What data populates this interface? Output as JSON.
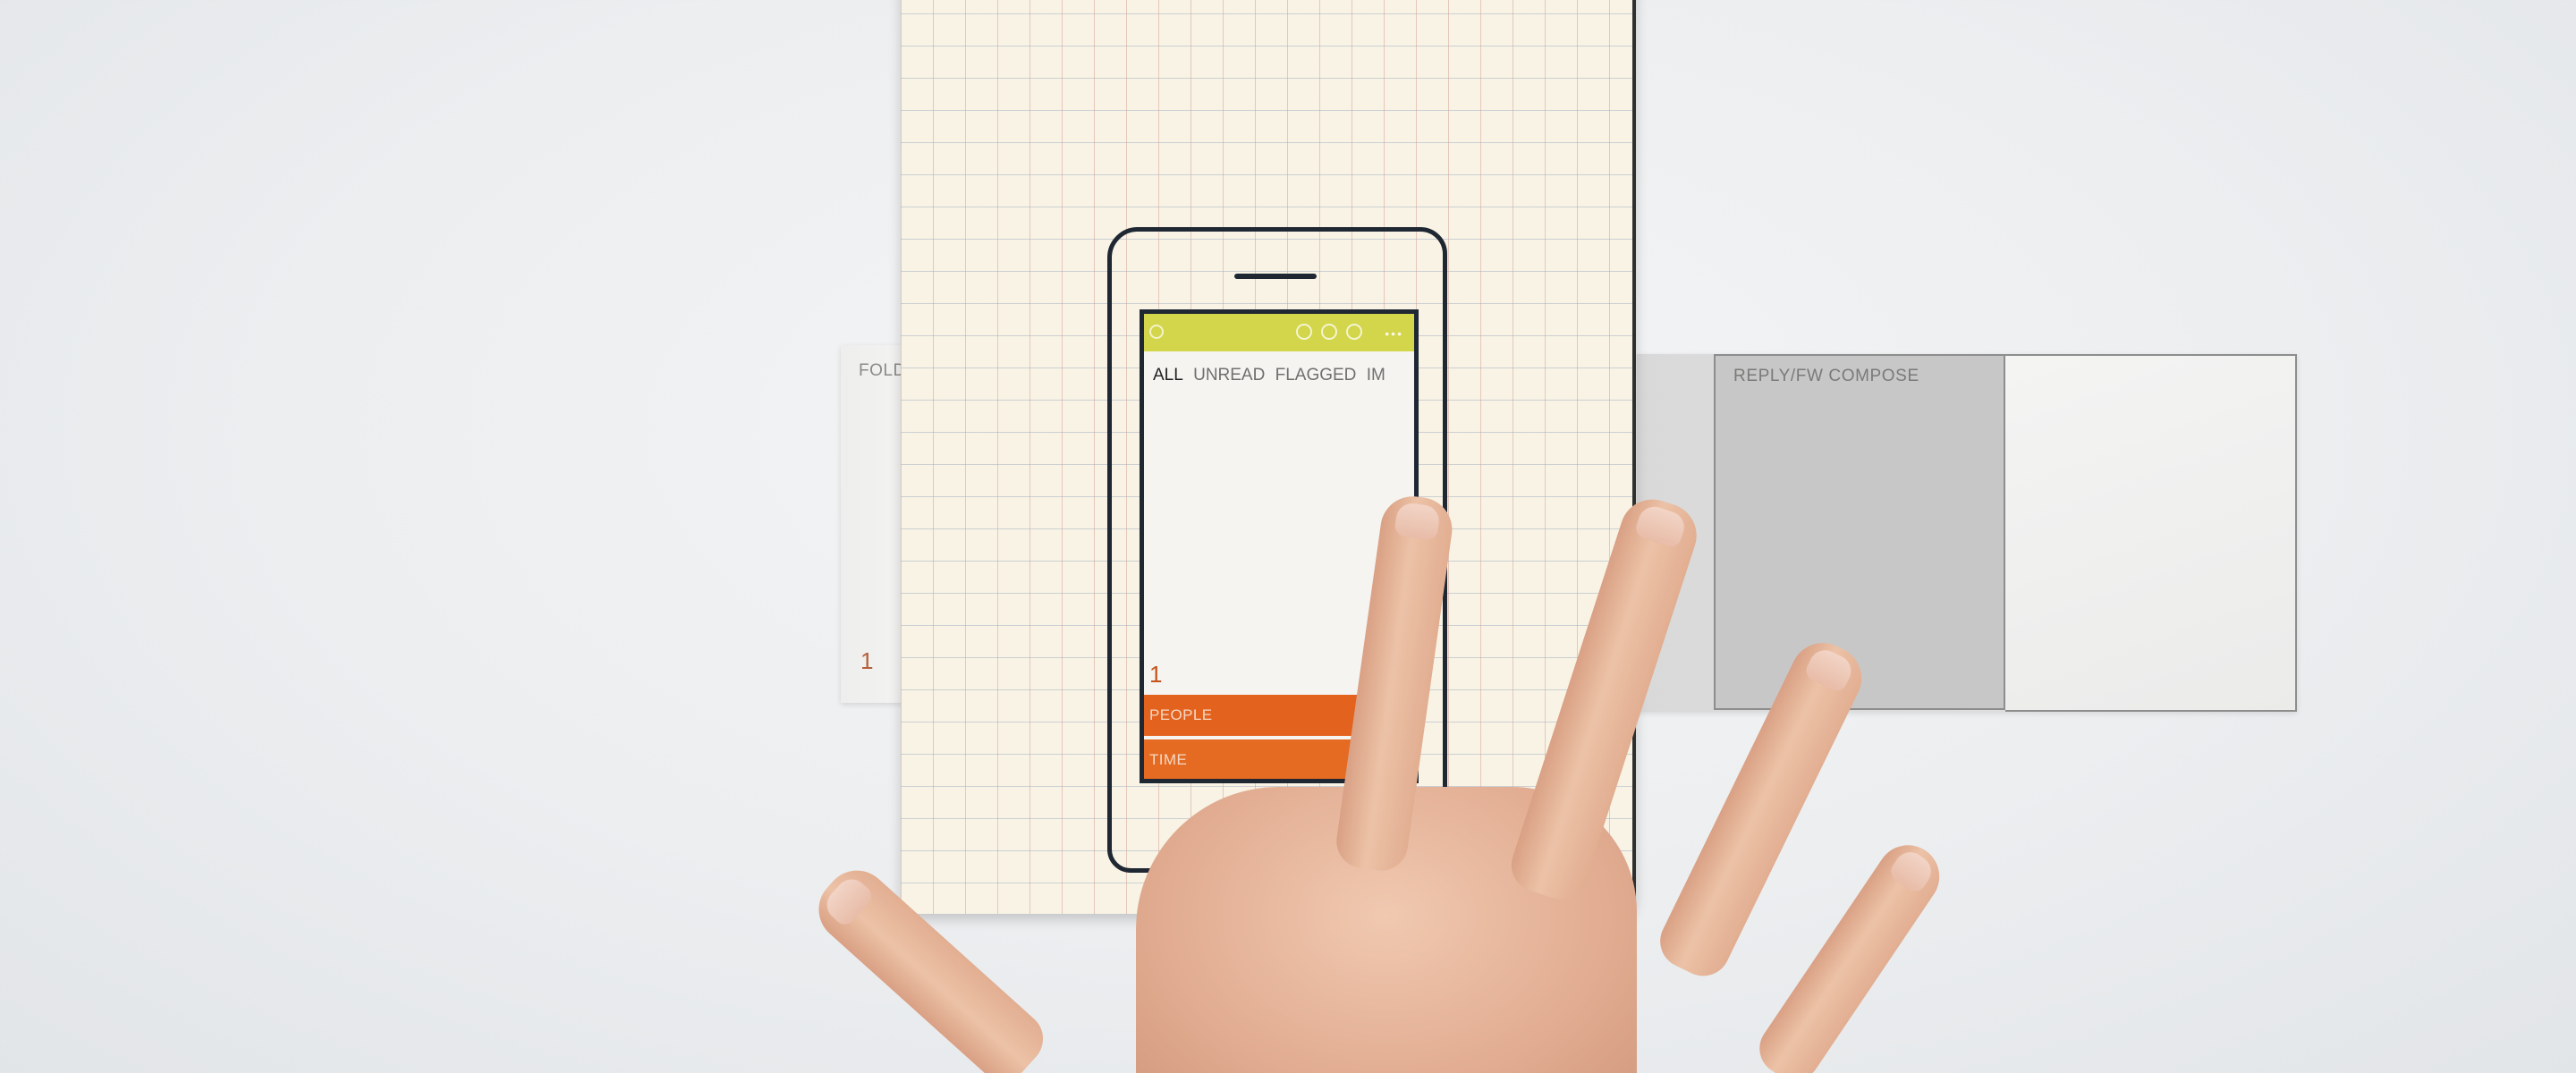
{
  "left_strip": {
    "label": "FOLDERS",
    "count": "1"
  },
  "right_strip": {
    "label": "REPLY/FW COMPOSE"
  },
  "phone": {
    "tabs": [
      "ALL",
      "UNREAD",
      "FLAGGED",
      "IM"
    ],
    "count": "1",
    "filters": [
      "PEOPLE",
      "TIME"
    ]
  },
  "colors": {
    "status_bar": "#d3d54a",
    "filter_bar": "#e2621e",
    "ink": "#1f2733",
    "notebook_paper": "#f8f3e4"
  }
}
